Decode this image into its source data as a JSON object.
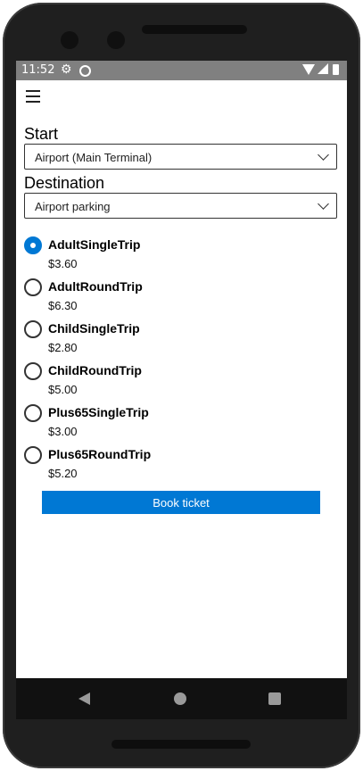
{
  "status": {
    "time": "11:52"
  },
  "form": {
    "start_label": "Start",
    "start_value": "Airport (Main Terminal)",
    "destination_label": "Destination",
    "destination_value": "Airport parking"
  },
  "tickets": [
    {
      "name": "AdultSingleTrip",
      "price": "$3.60",
      "selected": true
    },
    {
      "name": "AdultRoundTrip",
      "price": "$6.30",
      "selected": false
    },
    {
      "name": "ChildSingleTrip",
      "price": "$2.80",
      "selected": false
    },
    {
      "name": "ChildRoundTrip",
      "price": "$5.00",
      "selected": false
    },
    {
      "name": "Plus65SingleTrip",
      "price": "$3.00",
      "selected": false
    },
    {
      "name": "Plus65RoundTrip",
      "price": "$5.20",
      "selected": false
    }
  ],
  "book_button_label": "Book ticket",
  "colors": {
    "accent": "#0078d4",
    "status_bar": "#808080",
    "nav_bar": "#111111"
  },
  "icons": [
    "gear-icon",
    "sync-icon",
    "wifi-icon",
    "signal-icon",
    "battery-icon",
    "menu-icon",
    "chevron-down-icon",
    "back-icon",
    "home-icon",
    "recents-icon"
  ]
}
